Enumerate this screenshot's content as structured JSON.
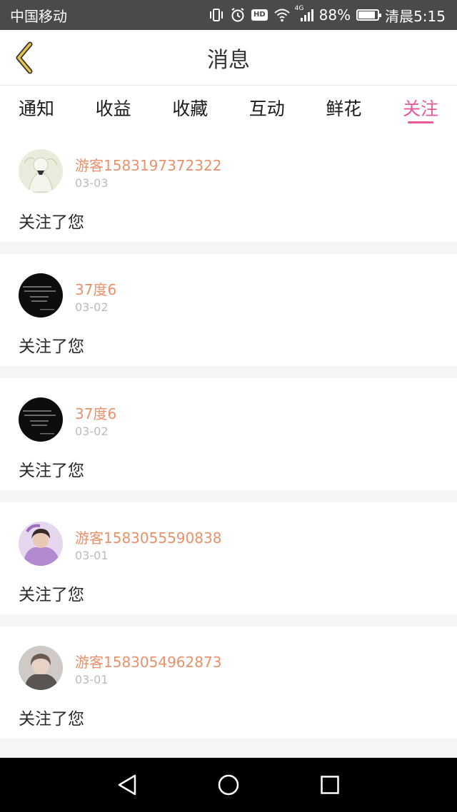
{
  "status_bar": {
    "carrier": "中国移动",
    "network": "4G",
    "battery_percent": "88%",
    "time": "清晨5:15",
    "hd_label": "HD",
    "battery_level": 0.88
  },
  "header": {
    "title": "消息"
  },
  "tabs": [
    {
      "label": "通知",
      "active": false
    },
    {
      "label": "收益",
      "active": false
    },
    {
      "label": "收藏",
      "active": false
    },
    {
      "label": "互动",
      "active": false
    },
    {
      "label": "鲜花",
      "active": false
    },
    {
      "label": "关注",
      "active": true
    }
  ],
  "colors": {
    "accent": "#e85a9a",
    "username": "#e8916a",
    "back_arrow": "#e8c34a"
  },
  "notifications": [
    {
      "username": "游客1583197372322",
      "date": "03-03",
      "message": "关注了您",
      "avatar": "light-sketch-avatar"
    },
    {
      "username": "37度6",
      "date": "03-02",
      "message": "关注了您",
      "avatar": "dark-text-avatar"
    },
    {
      "username": "37度6",
      "date": "03-02",
      "message": "关注了您",
      "avatar": "dark-text-avatar"
    },
    {
      "username": "游客1583055590838",
      "date": "03-01",
      "message": "关注了您",
      "avatar": "purple-photo-avatar"
    },
    {
      "username": "游客1583054962873",
      "date": "03-01",
      "message": "关注了您",
      "avatar": "portrait-photo-avatar"
    }
  ]
}
